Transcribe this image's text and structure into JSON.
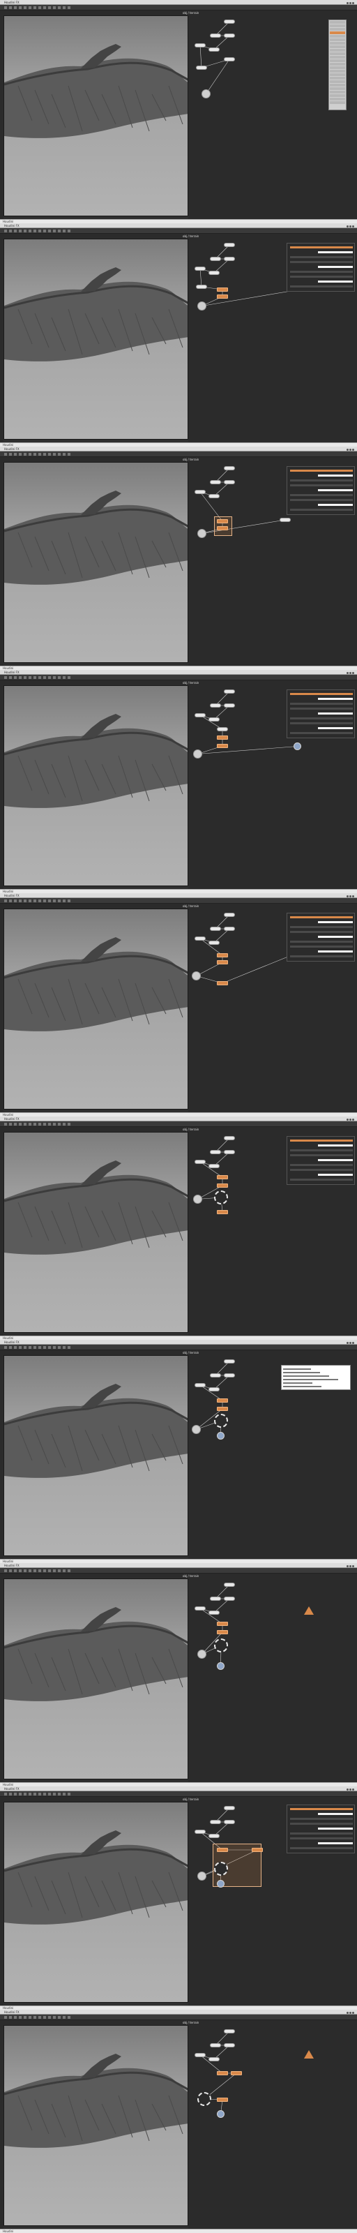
{
  "app": {
    "window_title": "Houdini FX",
    "tab_label": "obj / terrain",
    "status_text": "Houdini"
  },
  "icons": [
    "menu-icon",
    "node-icon",
    "warning-icon"
  ],
  "colors": {
    "graph_bg": "#2b2b2b",
    "viewport_bg": "#9d9d9d",
    "node_default": "#e8e8e8",
    "node_selected": "#d9894a",
    "wire": "#c9c9c9"
  },
  "frames": [
    {
      "id": 1,
      "state": "network with tab menu open"
    },
    {
      "id": 2,
      "state": "new node placed in network"
    },
    {
      "id": 3,
      "state": "nodes selected"
    },
    {
      "id": 4,
      "state": "nodes connected"
    },
    {
      "id": 5,
      "state": "nodes connected"
    },
    {
      "id": 6,
      "state": "solver node added"
    },
    {
      "id": 7,
      "state": "parameter editor open"
    },
    {
      "id": 8,
      "state": "warning flag on node"
    },
    {
      "id": 9,
      "state": "selection box over nodes"
    },
    {
      "id": 10,
      "state": "nodes duplicated"
    }
  ]
}
